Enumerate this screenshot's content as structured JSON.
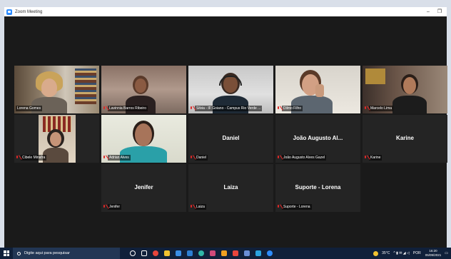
{
  "window": {
    "title": "Zoom Meeting",
    "minimize": "–",
    "restore": "❐"
  },
  "tiles": [
    {
      "name": "Lorena Gomes",
      "video": true
    },
    {
      "name": "Lavinnia Barros Ribeiro",
      "video": true
    },
    {
      "name": "Silvia - IF Goiano - Campus Rio Verde ...",
      "video": true
    },
    {
      "name": "Dilmo Filho",
      "video": true
    },
    {
      "name": "Marcelo Lima",
      "video": true
    },
    {
      "name": "Cibele Minafra",
      "video": true
    },
    {
      "name": "Adrian Alves",
      "video": true,
      "speaking": true
    },
    {
      "name": "Daniel",
      "display": "Daniel"
    },
    {
      "name": "João Augusto Alves Gazel",
      "display": "João Augusto Al..."
    },
    {
      "name": "Karine",
      "display": "Karine"
    },
    {
      "name": "Jenifer",
      "display": "Jenifer"
    },
    {
      "name": "Laiza",
      "display": "Laiza"
    },
    {
      "name": "Suporte - Lorena",
      "display": "Suporte - Lorena"
    }
  ],
  "taskbar": {
    "search_placeholder": "Digite aqui para pesquisar",
    "weather": "35°C",
    "language": "POR",
    "time": "16:20",
    "date": "05/09/2021"
  },
  "colors": {
    "speaking_border": "#9ed11e",
    "muted_mic": "#e02828",
    "zoom_blue": "#2d8cff"
  }
}
